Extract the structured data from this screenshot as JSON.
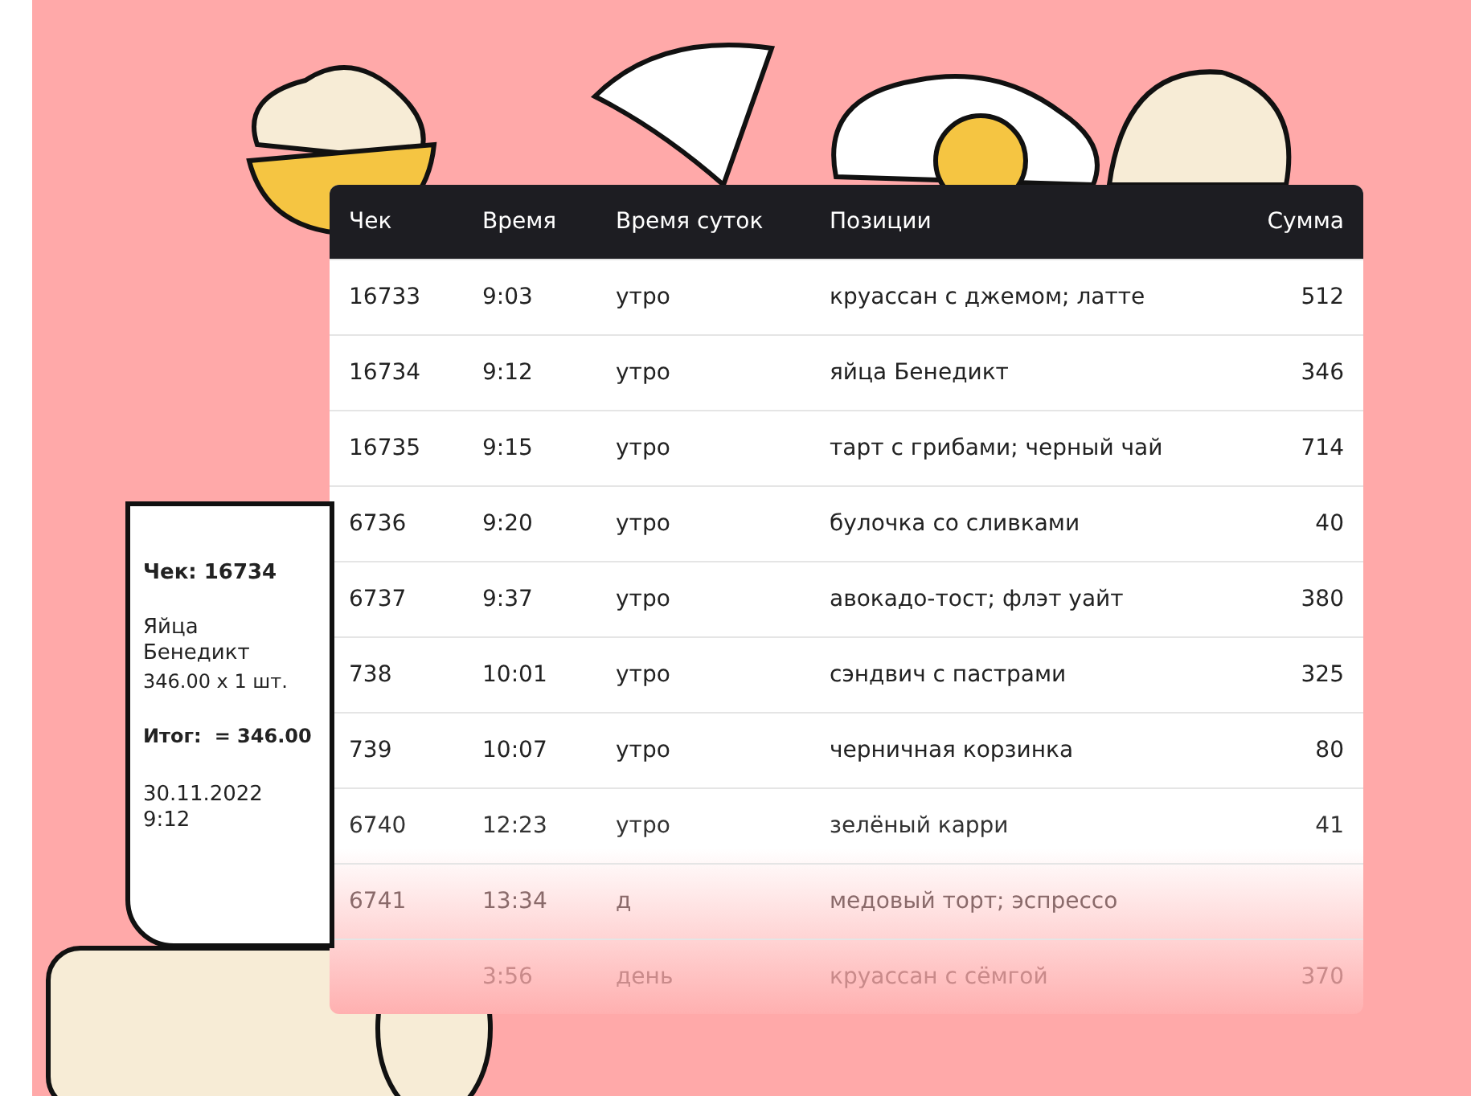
{
  "table": {
    "columns": [
      "Чек",
      "Время",
      "Время суток",
      "Позиции",
      "Сумма"
    ],
    "rows": [
      [
        "16733",
        "9:03",
        "утро",
        "круассан с джемом; латте",
        "512"
      ],
      [
        "16734",
        "9:12",
        "утро",
        "яйца Бенедикт",
        "346"
      ],
      [
        "16735",
        "9:15",
        "утро",
        "тарт с грибами; черный чай",
        "714"
      ],
      [
        "6736",
        "9:20",
        "утро",
        "булочка со сливками",
        "40"
      ],
      [
        "6737",
        "9:37",
        "утро",
        "авокадо-тост; флэт уайт",
        "380"
      ],
      [
        "738",
        "10:01",
        "утро",
        "сэндвич с пастрами",
        "325"
      ],
      [
        "739",
        "10:07",
        "утро",
        "черничная корзинка",
        "80"
      ],
      [
        "6740",
        "12:23",
        "утро",
        "зелёный карри",
        "41"
      ],
      [
        "6741",
        "13:34",
        "д",
        "медовый торт; эспрессо",
        ""
      ],
      [
        "",
        "3:56",
        "день",
        "круассан с сёмгой",
        "370"
      ]
    ]
  },
  "receipt": {
    "title": "Чек: 16734",
    "item": "Яйца\nБенедикт",
    "price": "346.00 х 1 шт.",
    "total_label": "Итог:",
    "total": "= 346.00",
    "date": "30.11.2022",
    "time": "9:12"
  }
}
